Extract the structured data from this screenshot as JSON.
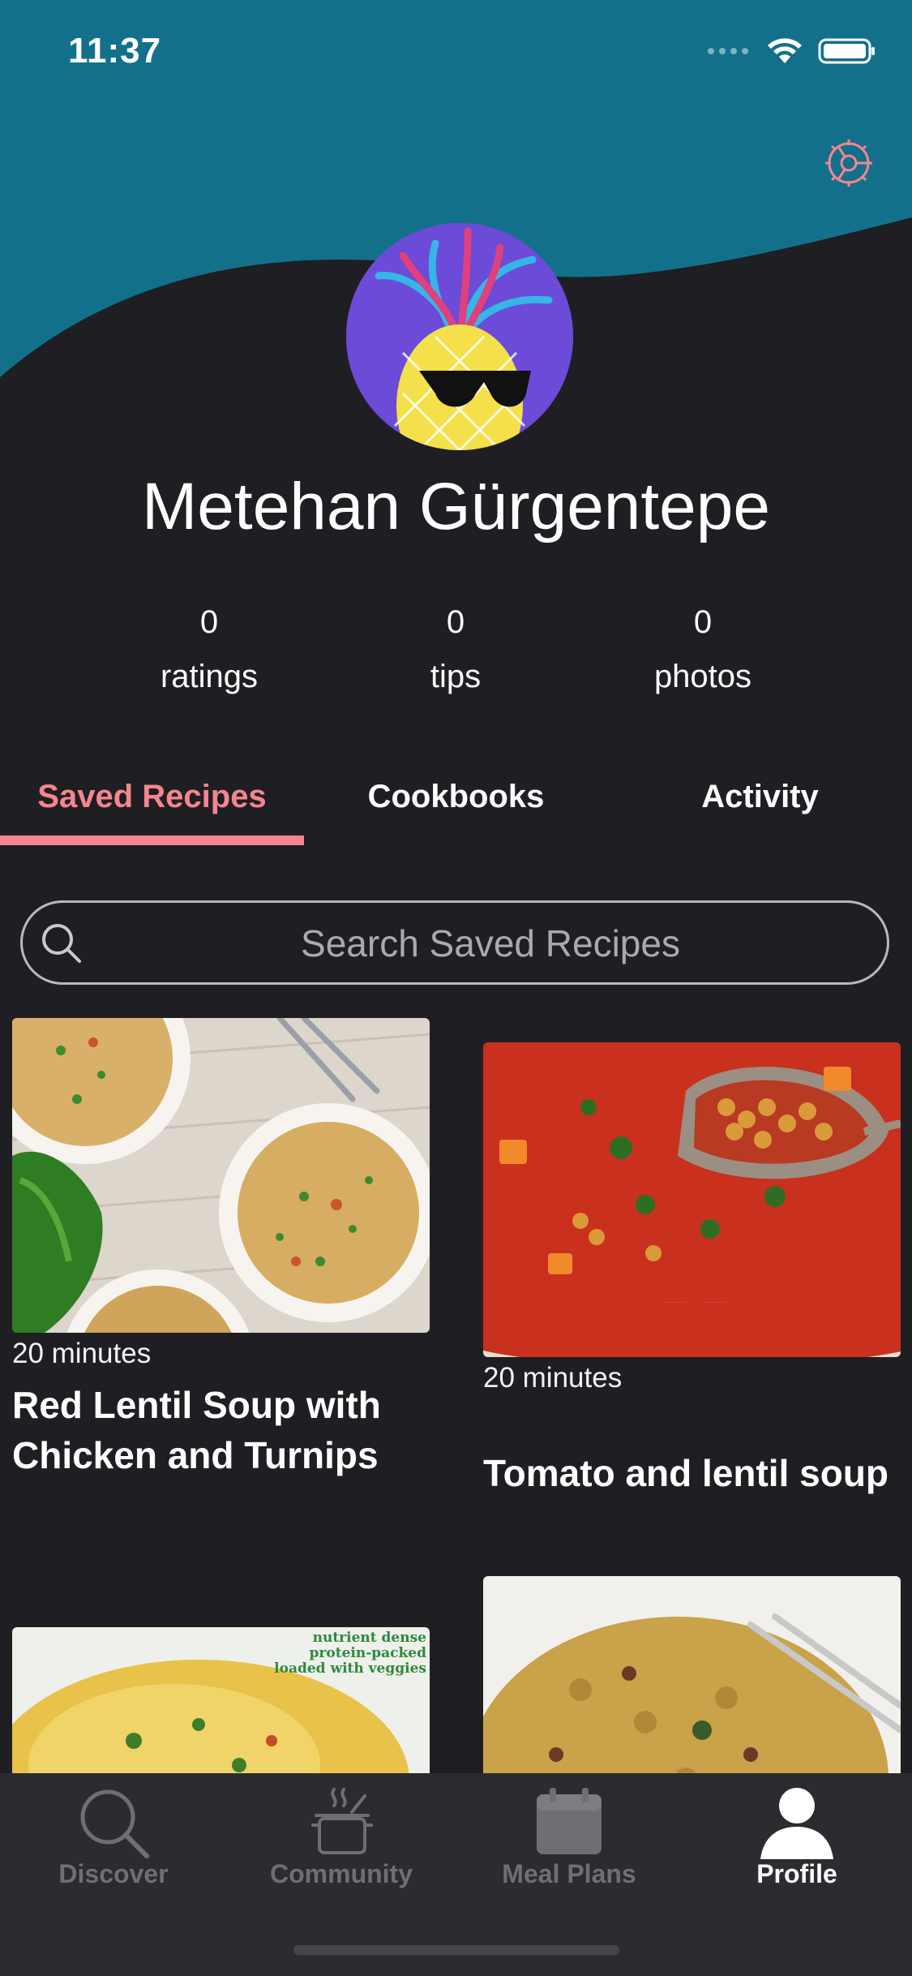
{
  "status": {
    "time": "11:37"
  },
  "profile": {
    "name": "Metehan Gürgentepe",
    "stats": [
      {
        "value": "0",
        "label": "ratings"
      },
      {
        "value": "0",
        "label": "tips"
      },
      {
        "value": "0",
        "label": "photos"
      }
    ]
  },
  "tabs": [
    {
      "label": "Saved Recipes",
      "active": true
    },
    {
      "label": "Cookbooks",
      "active": false
    },
    {
      "label": "Activity",
      "active": false
    }
  ],
  "search": {
    "placeholder": "Search Saved Recipes"
  },
  "recipes": [
    {
      "time": "20 minutes",
      "title_line1": "Red Lentil Soup with",
      "title_line2": "Chicken and Turnips"
    },
    {
      "time": "20 minutes",
      "title_line1": "Tomato and lentil soup"
    },
    {
      "overlay_text_1": "nutrient dense",
      "overlay_text_2": "protein-packed",
      "overlay_text_3": "loaded with veggies"
    }
  ],
  "nav": [
    {
      "label": "Discover",
      "icon": "search-icon"
    },
    {
      "label": "Community",
      "icon": "pot-icon"
    },
    {
      "label": "Meal Plans",
      "icon": "calendar-icon"
    },
    {
      "label": "Profile",
      "icon": "person-icon",
      "active": true
    }
  ],
  "colors": {
    "header": "#13708b",
    "accent": "#f3868f",
    "background": "#1f1e23",
    "tabbar": "#2c2c30"
  }
}
